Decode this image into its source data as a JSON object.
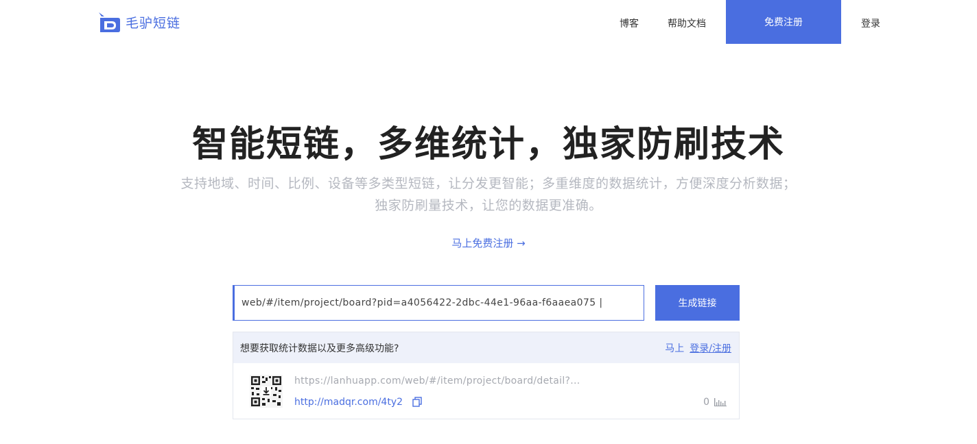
{
  "header": {
    "logo_text": "毛驴短链",
    "nav": {
      "blog": "博客",
      "docs": "帮助文档",
      "register": "免费注册",
      "login": "登录"
    }
  },
  "hero": {
    "title": "智能短链，多维统计，独家防刷技术",
    "subtitle_line1": "支持地域、时间、比例、设备等多类型短链，让分发更智能；多重维度的数据统计，方便深度分析数据；",
    "subtitle_line2": "独家防刷量技术，让您的数据更准确。",
    "cta": "马上免费注册 →"
  },
  "shortener": {
    "input_value": "web/#/item/project/board?pid=a4056422-2dbc-44e1-96aa-f6aaea075 |",
    "generate_button": "生成链接"
  },
  "result_panel": {
    "prompt": "想要获取统计数据以及更多高级功能?",
    "prefix": "马上",
    "login_register": "登录/注册",
    "item": {
      "long_url": "https://lanhuapp.com/web/#/item/project/board/detail?...",
      "short_url": "http://madqr.com/4ty2",
      "clicks": "0"
    }
  },
  "colors": {
    "accent": "#4a6ee0",
    "panel_head_bg": "#eef1fa",
    "muted_text": "#b5b8c0"
  }
}
